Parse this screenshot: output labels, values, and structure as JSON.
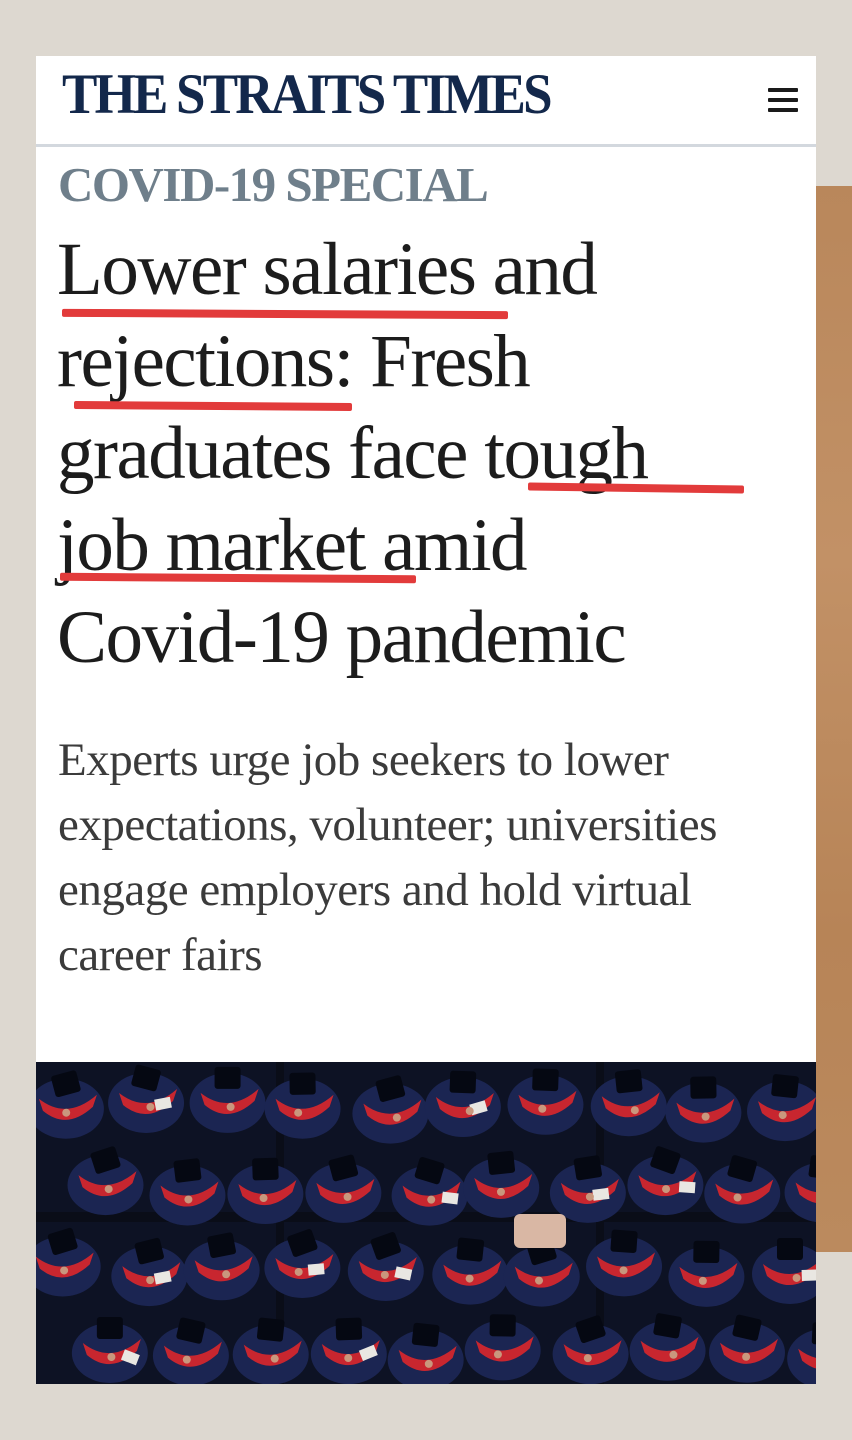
{
  "masthead": {
    "logo": "THE STRAITS TIMES",
    "menu_icon": "hamburger-menu-icon"
  },
  "article": {
    "kicker": "COVID-19 SPECIAL",
    "headline_lines": [
      "Lower salaries and",
      "rejections: Fresh",
      "graduates face tough",
      "job market amid",
      "Covid-19 pandemic"
    ],
    "underlined_phrases": [
      "Lower salaries",
      "rejections",
      "tough",
      "job market"
    ],
    "standfirst_lines": [
      "Experts urge job seekers to lower",
      "expectations, volunteer; universities",
      "engage employers and hold virtual",
      "career fairs"
    ],
    "hero_image": "graduates-in-red-and-navy-gowns-photo"
  },
  "colors": {
    "masthead_text": "#13284b",
    "kicker": "#6f7f8b",
    "headline": "#1c1c1c",
    "underline": "#e23b3b",
    "standfirst": "#3b3b3b",
    "gown_navy": "#1b2552",
    "gown_red": "#c8262f",
    "background": "#ddd8d0"
  }
}
